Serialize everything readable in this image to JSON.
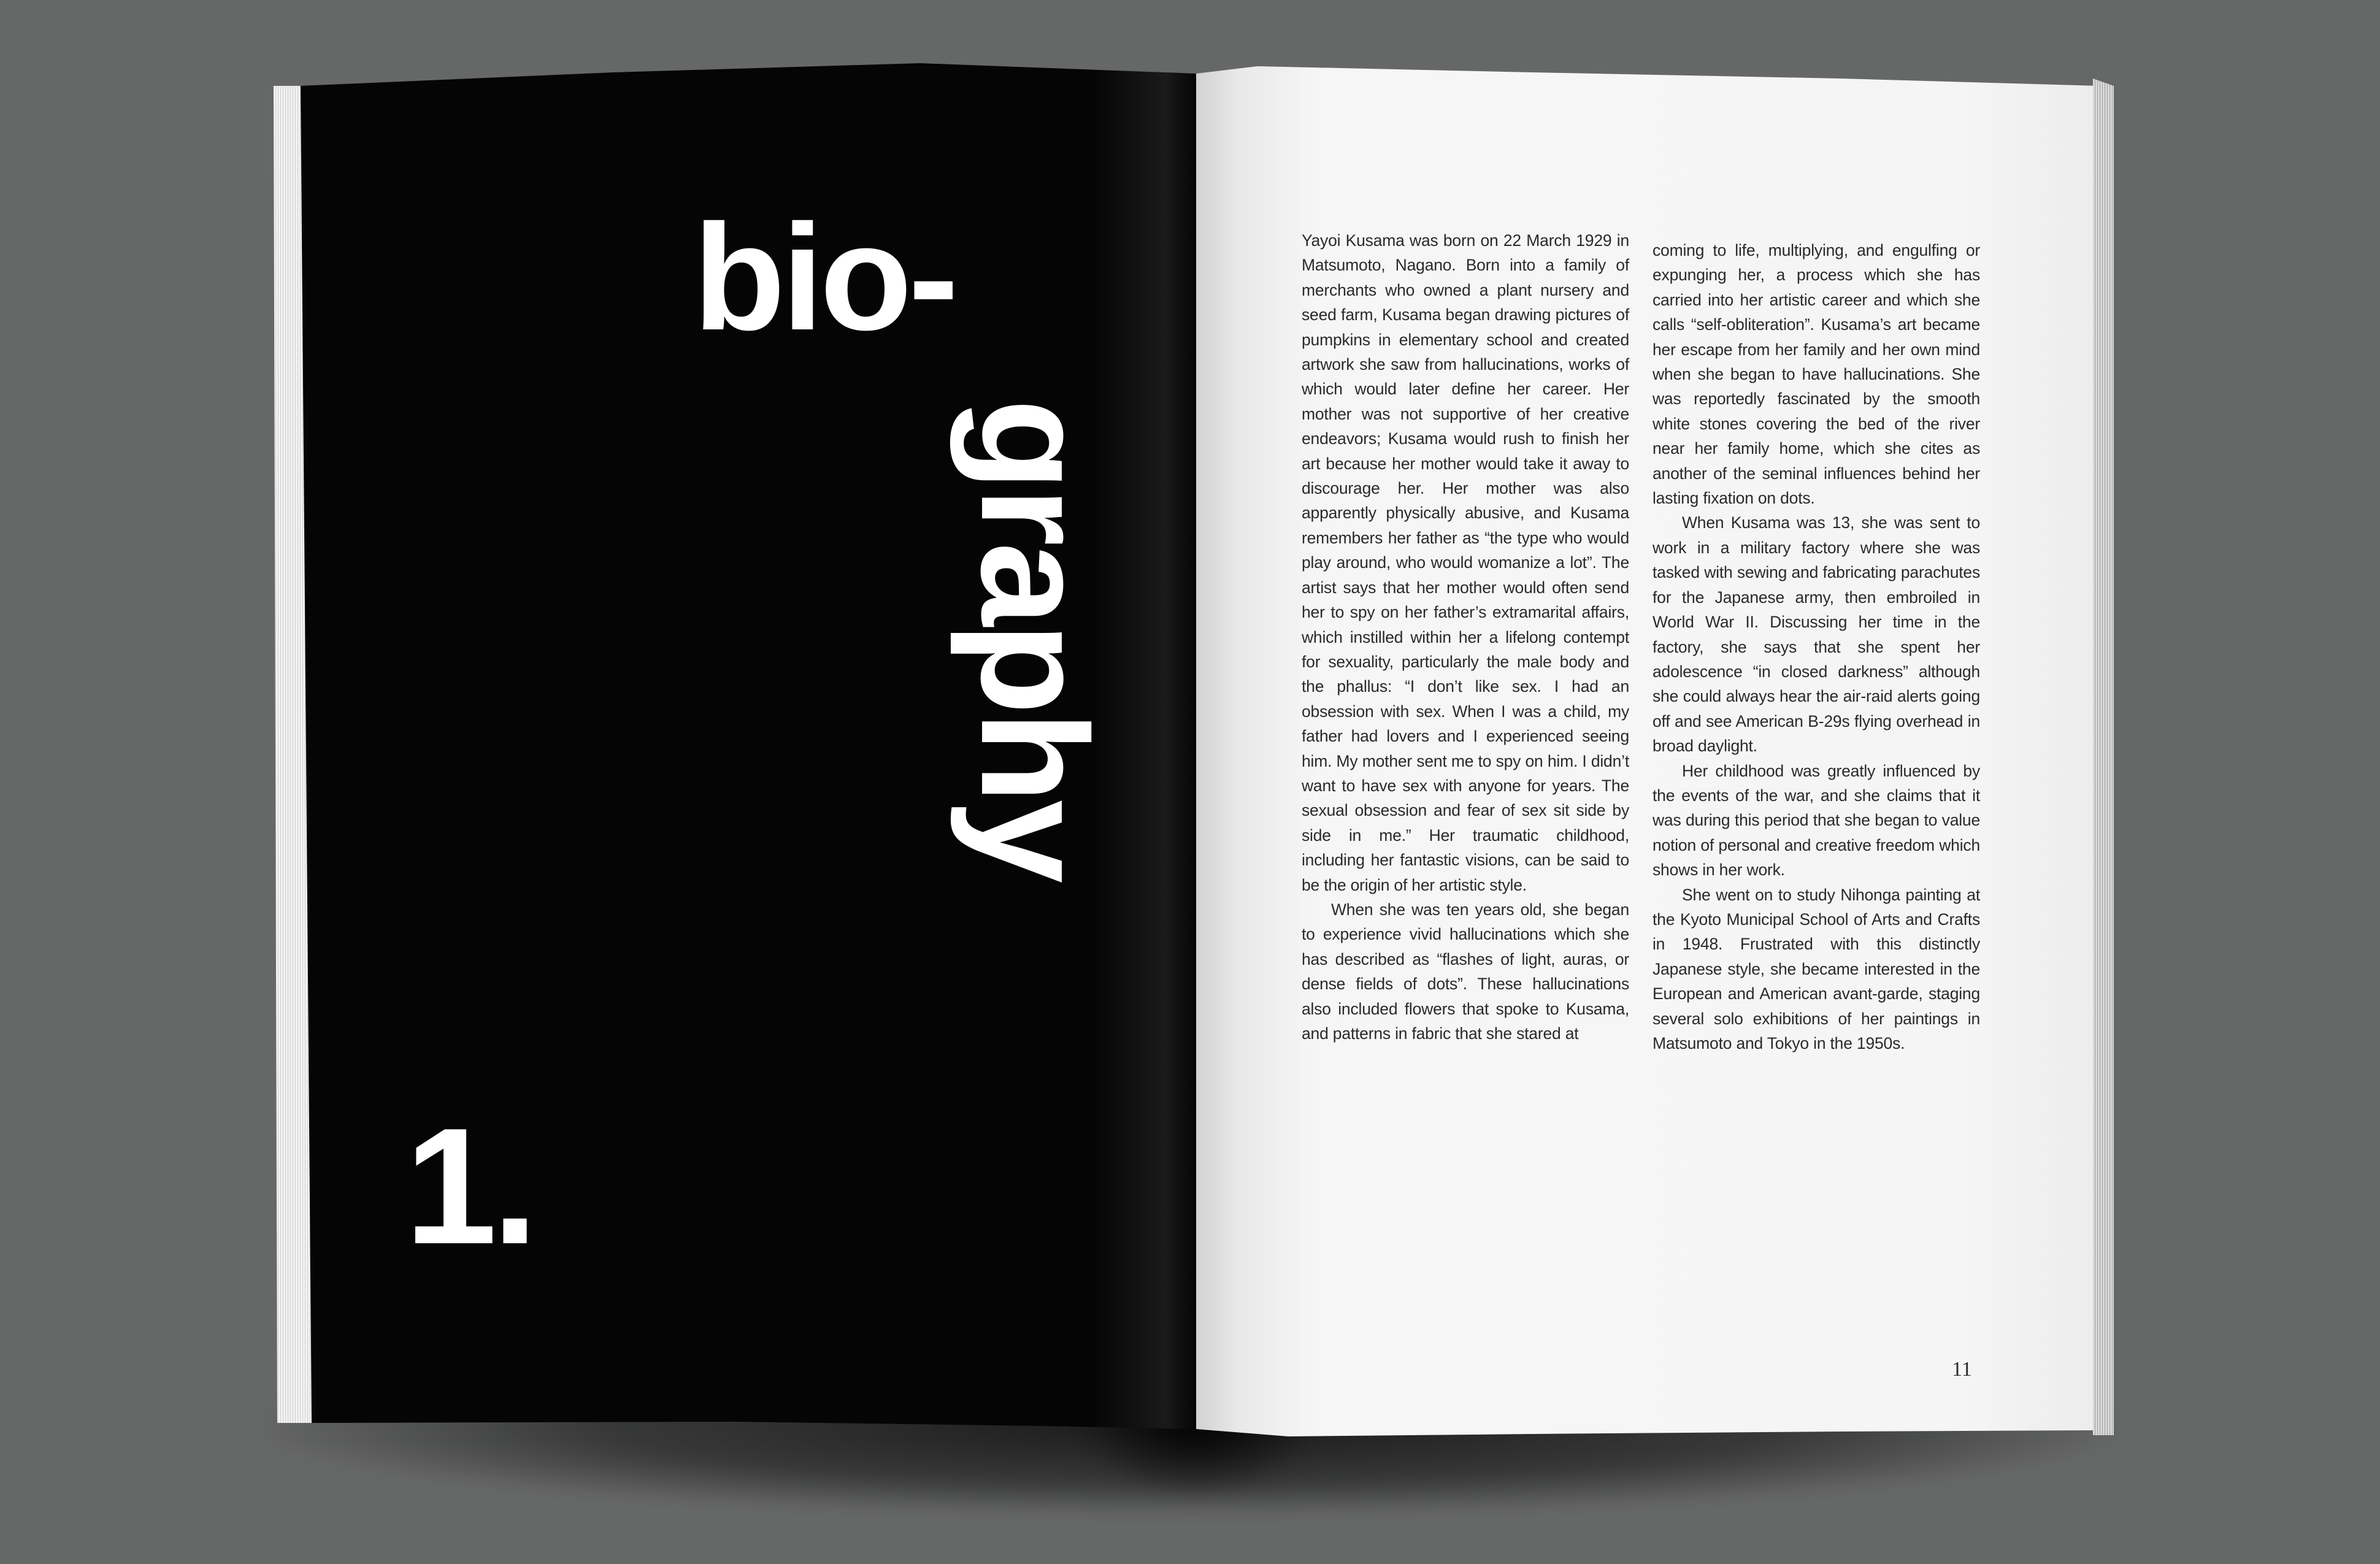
{
  "left_page": {
    "title_line1": "bio-",
    "title_line2": "graphy",
    "chapter_number": "1."
  },
  "right_page": {
    "column_left": [
      "Yayoi Kusama was born on 22 March 1929 in Matsumoto, Nagano. Born into a family of merchants who owned a plant nursery and seed farm, Kusama began drawing pictures of pumpkins in elementary school and created artwork she saw from hallucinations, works of which would later define her career. Her mother was not supportive of her creative endeavors; Kusama would rush to finish her art because her mother would take it away to discourage her. Her mother was also apparently physically abusive, and Kusama remembers her father as “the type who would play around, who would womanize a lot”. The artist says that her mother would often send her to spy on her father’s extramarital affairs, which instilled within her a lifelong contempt for sexuality, particularly the male body and the phallus: “I don’t like sex. I had an obsession with sex. When I was a child, my father had lovers and I experienced seeing him. My mother sent me to spy on him. I didn’t want to have sex with anyone for years. The sexual obsession and fear of sex sit side by side in me.” Her traumatic childhood, including her fantastic visions, can be said to be the origin of her artistic style.",
      "When she was ten years old, she began to experience vivid hallucinations which she has described as “flashes of light, auras, or dense fields of dots”. These hallucinations also included flowers that spoke to Kusama, and patterns in fabric that she stared at"
    ],
    "column_right": [
      "coming to life, multiplying, and engulfing or expunging her, a process which she has carried into her artistic career and which she calls “self-obliteration”. Kusama’s art became her escape from her family and her own mind when she began to have hallucinations. She was reportedly fascinated by the smooth white stones covering the bed of the river near her family home, which she cites as another of the seminal influences behind her lasting fixation on dots.",
      "When Kusama was 13, she was sent to work in a military factory where she was tasked with sewing and fabricating parachutes for the Japanese army, then embroiled in World War II. Discussing her time in the factory, she says that she spent her adolescence “in closed darkness” although she could always hear the air-raid alerts going off and see American B-29s flying overhead in broad daylight.",
      "Her childhood was greatly influenced by the events of the war, and she claims that it was during this period that she began to value notion of personal and creative freedom which shows in her work.",
      "She went on to study Nihonga painting at the Kyoto Municipal School of Arts and Crafts in 1948. Frustrated with this distinctly Japanese style, she became interested in the European and American avant-garde, staging several solo exhibitions of her paintings in Matsumoto and Tokyo in the 1950s."
    ],
    "page_number": "11"
  }
}
